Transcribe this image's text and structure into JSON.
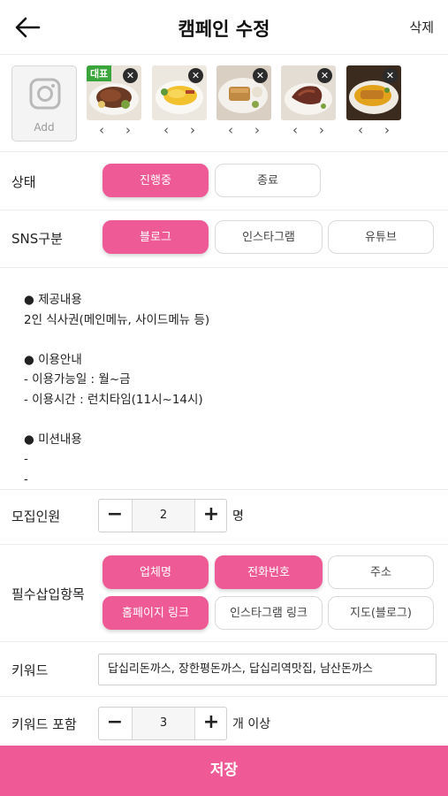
{
  "header": {
    "title": "캠페인 수정",
    "delete_label": "삭제"
  },
  "photos": {
    "add_label": "Add",
    "representative_badge": "대표",
    "items": [
      {
        "icon": "food-photo-steak"
      },
      {
        "icon": "food-photo-omelette"
      },
      {
        "icon": "food-photo-cutlet-platter"
      },
      {
        "icon": "food-photo-meat-dish"
      },
      {
        "icon": "food-photo-curry-cutlet"
      }
    ]
  },
  "status": {
    "label": "상태",
    "options": [
      "진행중",
      "종료"
    ],
    "selected": "진행중"
  },
  "sns": {
    "label": "SNS구분",
    "options": [
      "블로그",
      "인스타그램",
      "유튜브"
    ],
    "selected": "블로그"
  },
  "description": {
    "lines": [
      "● 제공내용",
      "2인 식사권(메인메뉴, 사이드메뉴 등)",
      "",
      "● 이용안내",
      "- 이용가능일 : 월~금",
      "- 이용시간 : 런치타임(11시~14시)",
      "",
      "● 미션내용",
      "-",
      "-"
    ]
  },
  "recruit": {
    "label": "모집인원",
    "value": "2",
    "unit": "명",
    "minus": "−",
    "plus": "+"
  },
  "required": {
    "label": "필수삽입항목",
    "options": [
      "업체명",
      "전화번호",
      "주소",
      "홈페이지 링크",
      "인스타그램 링크",
      "지도(블로그)"
    ],
    "selected": [
      "업체명",
      "전화번호",
      "홈페이지 링크"
    ]
  },
  "keywords": {
    "label": "키워드",
    "value": "답십리돈까스, 장한평돈까스, 답십리역맛집, 남산돈까스"
  },
  "keyword_include": {
    "label": "키워드 포함",
    "value": "3",
    "unit": "개 이상",
    "minus": "−",
    "plus": "+"
  },
  "save_label": "저장",
  "colors": {
    "accent": "#ee5a95",
    "badge_green": "#3aa53a"
  }
}
